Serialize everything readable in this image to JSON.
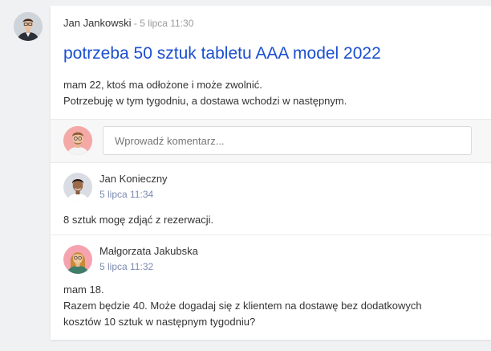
{
  "post": {
    "author": "Jan Jankowski",
    "separator": " - ",
    "date": "5 lipca 11:30",
    "title": "potrzeba 50 sztuk tabletu AAA model 2022",
    "body_lines": [
      "mam 22, ktoś ma odłożone i może zwolnić.",
      "Potrzebuję w tym tygodniu, a dostawa wchodzi w następnym."
    ]
  },
  "comment_form": {
    "placeholder": "Wprowadź komentarz..."
  },
  "comments": [
    {
      "author": "Jan Konieczny",
      "date": "5 lipca 11:34",
      "lines": [
        "8 sztuk mogę zdjąć z rezerwacji."
      ]
    },
    {
      "author": "Małgorzata Jakubska",
      "date": "5 lipca 11:32",
      "lines": [
        "mam 18.",
        "Razem będzie 40. Może dogadaj się z klientem na dostawę bez dodatkowych",
        "kosztów 10 sztuk w następnym tygodniu?"
      ]
    }
  ],
  "colors": {
    "title": "#1a4fcf",
    "comment_date": "#7b8ab0",
    "background": "#f0f1f3"
  },
  "icons": {
    "author_avatar": "man-avatar",
    "current_user_avatar": "man-avatar",
    "comment_1_avatar": "man-avatar",
    "comment_2_avatar": "woman-avatar"
  }
}
